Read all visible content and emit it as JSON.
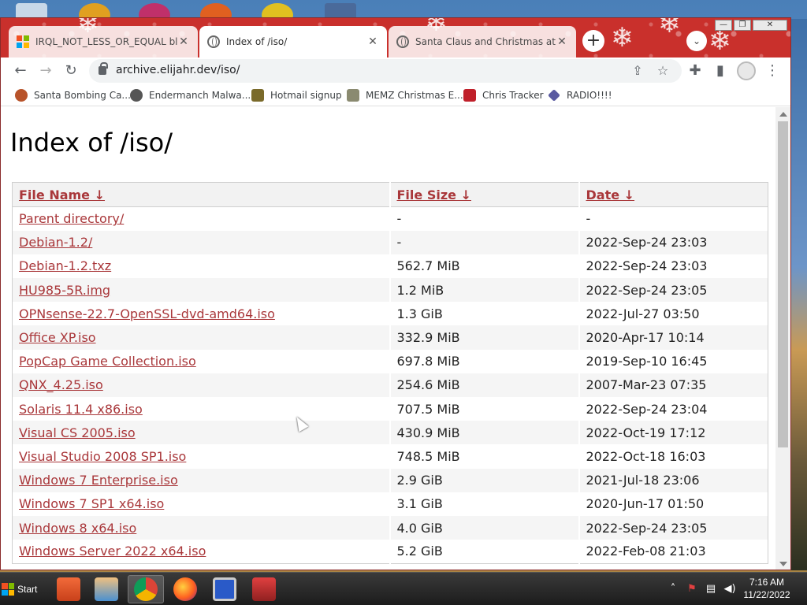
{
  "browser": {
    "tabs": [
      {
        "title": "IRQL_NOT_LESS_OR_EQUAL blue",
        "favicon": "microsoft-icon",
        "active": false
      },
      {
        "title": "Index of /iso/",
        "favicon": "globe-icon",
        "active": true
      },
      {
        "title": "Santa Claus and Christmas at the",
        "favicon": "globe-icon",
        "active": false
      }
    ],
    "address": "archive.elijahr.dev/iso/",
    "bookmarks": [
      {
        "label": "Santa Bombing Ca...",
        "icon": "santa-icon"
      },
      {
        "label": "Endermanch Malwa...",
        "icon": "cat-icon"
      },
      {
        "label": "Hotmail signup",
        "icon": "person-icon"
      },
      {
        "label": "MEMZ Christmas E...",
        "icon": "snake-icon"
      },
      {
        "label": "Chris Tracker",
        "icon": "star-icon"
      },
      {
        "label": "RADIO!!!!",
        "icon": "diamond-icon"
      }
    ]
  },
  "page": {
    "title": "Index of /iso/",
    "columns": {
      "name": "File Name  ↓",
      "size": "File Size  ↓",
      "date": "Date  ↓"
    },
    "rows": [
      {
        "name": "Parent directory/",
        "size": "-",
        "date": "-"
      },
      {
        "name": "Debian-1.2/",
        "size": "-",
        "date": "2022-Sep-24 23:03"
      },
      {
        "name": "Debian-1.2.txz",
        "size": "562.7 MiB",
        "date": "2022-Sep-24 23:03"
      },
      {
        "name": "HU985-5R.img",
        "size": "1.2 MiB",
        "date": "2022-Sep-24 23:05"
      },
      {
        "name": "OPNsense-22.7-OpenSSL-dvd-amd64.iso",
        "size": "1.3 GiB",
        "date": "2022-Jul-27 03:50"
      },
      {
        "name": "Office XP.iso",
        "size": "332.9 MiB",
        "date": "2020-Apr-17 10:14"
      },
      {
        "name": "PopCap Game Collection.iso",
        "size": "697.8 MiB",
        "date": "2019-Sep-10 16:45"
      },
      {
        "name": "QNX_4.25.iso",
        "size": "254.6 MiB",
        "date": "2007-Mar-23 07:35"
      },
      {
        "name": "Solaris 11.4 x86.iso",
        "size": "707.5 MiB",
        "date": "2022-Sep-24 23:04"
      },
      {
        "name": "Visual CS 2005.iso",
        "size": "430.9 MiB",
        "date": "2022-Oct-19 17:12"
      },
      {
        "name": "Visual Studio 2008 SP1.iso",
        "size": "748.5 MiB",
        "date": "2022-Oct-18 16:03"
      },
      {
        "name": "Windows 7 Enterprise.iso",
        "size": "2.9 GiB",
        "date": "2021-Jul-18 23:06"
      },
      {
        "name": "Windows 7 SP1 x64.iso",
        "size": "3.1 GiB",
        "date": "2020-Jun-17 01:50"
      },
      {
        "name": "Windows 8 x64.iso",
        "size": "4.0 GiB",
        "date": "2022-Sep-24 23:05"
      },
      {
        "name": "Windows Server 2022 x64.iso",
        "size": "5.2 GiB",
        "date": "2022-Feb-08 21:03"
      }
    ]
  },
  "taskbar": {
    "start_label": "Start",
    "apps": [
      "folder-icon",
      "media-player-icon",
      "chrome-icon",
      "firefox-icon",
      "monitor-icon",
      "toolbox-icon"
    ],
    "time": "7:16 AM",
    "date": "11/22/2022"
  },
  "colors": {
    "link": "#a9373a",
    "tabstrip": "#c9302c"
  }
}
